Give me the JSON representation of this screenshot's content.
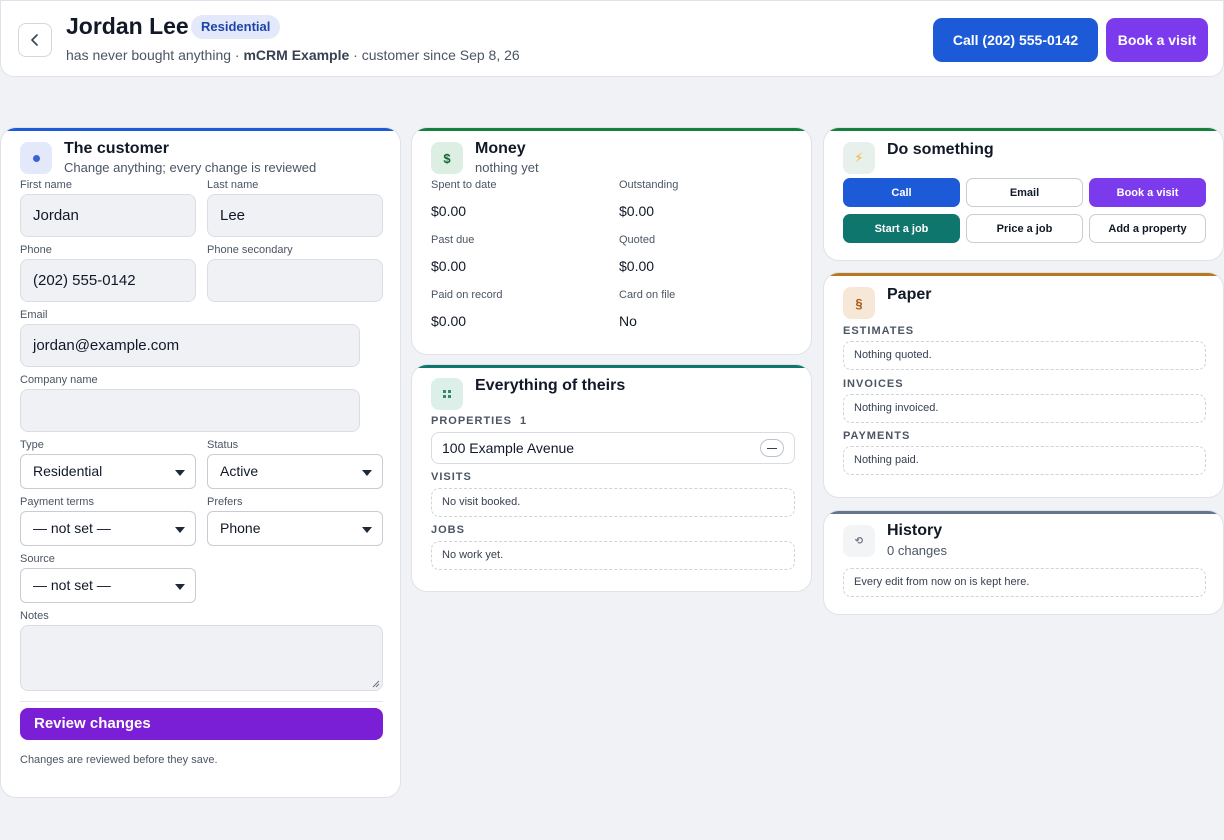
{
  "header": {
    "name": "Jordan Lee",
    "badge": "Residential",
    "sub_prefix": "has never bought anything ·",
    "sub_company": "mCRM Example",
    "sub_suffix": "· customer since Sep 8, 26",
    "call_label": "Call (202) 555-0142",
    "book_label": "Book a visit",
    "colors": {
      "call": "#1d5ad8",
      "book": "#7c3aed"
    }
  },
  "customer": {
    "title": "The customer",
    "subtitle": "Change anything; every change is reviewed",
    "fields": {
      "first_name": {
        "label": "First name",
        "value": "Jordan"
      },
      "last_name": {
        "label": "Last name",
        "value": "Lee"
      },
      "phone": {
        "label": "Phone",
        "value": "(202) 555-0142"
      },
      "phone_secondary": {
        "label": "Phone secondary",
        "value": ""
      },
      "email": {
        "label": "Email",
        "value": "jordan@example.com"
      },
      "company_name": {
        "label": "Company name",
        "value": ""
      },
      "type": {
        "label": "Type",
        "value": "Residential"
      },
      "status": {
        "label": "Status",
        "value": "Active"
      },
      "payment_terms": {
        "label": "Payment terms",
        "value": "— not set —"
      },
      "prefers": {
        "label": "Prefers",
        "value": "Phone"
      },
      "source": {
        "label": "Source",
        "value": "— not set —"
      },
      "notes": {
        "label": "Notes",
        "value": ""
      }
    },
    "review_button": "Review changes",
    "review_note": "Changes are reviewed before they save."
  },
  "money": {
    "title": "Money",
    "subtitle": "nothing yet",
    "icon": "$",
    "items": [
      {
        "label": "Spent to date",
        "value": "$0.00"
      },
      {
        "label": "Outstanding",
        "value": "$0.00"
      },
      {
        "label": "Past due",
        "value": "$0.00"
      },
      {
        "label": "Quoted",
        "value": "$0.00"
      },
      {
        "label": "Paid on record",
        "value": "$0.00"
      },
      {
        "label": "Card on file",
        "value": "No"
      }
    ]
  },
  "theirs": {
    "title": "Everything of theirs",
    "properties_label": "PROPERTIES",
    "properties_count": "1",
    "property": "100 Example Avenue",
    "visits_label": "VISITS",
    "visits_empty": "No visit booked.",
    "jobs_label": "JOBS",
    "jobs_empty": "No work yet."
  },
  "actions": {
    "title": "Do something",
    "buttons": [
      "Call",
      "Email",
      "Book a visit",
      "Start a job",
      "Price a job",
      "Add a property"
    ],
    "colors": {
      "call": "#1d5ad8",
      "book": "#7c3aed",
      "start": "#0f766e"
    }
  },
  "paper": {
    "title": "Paper",
    "icon": "§",
    "estimates_label": "ESTIMATES",
    "estimates_empty": "Nothing quoted.",
    "invoices_label": "INVOICES",
    "invoices_empty": "Nothing invoiced.",
    "payments_label": "PAYMENTS",
    "payments_empty": "Nothing paid."
  },
  "history": {
    "title": "History",
    "subtitle": "0 changes",
    "note": "Every edit from now on is kept here."
  }
}
